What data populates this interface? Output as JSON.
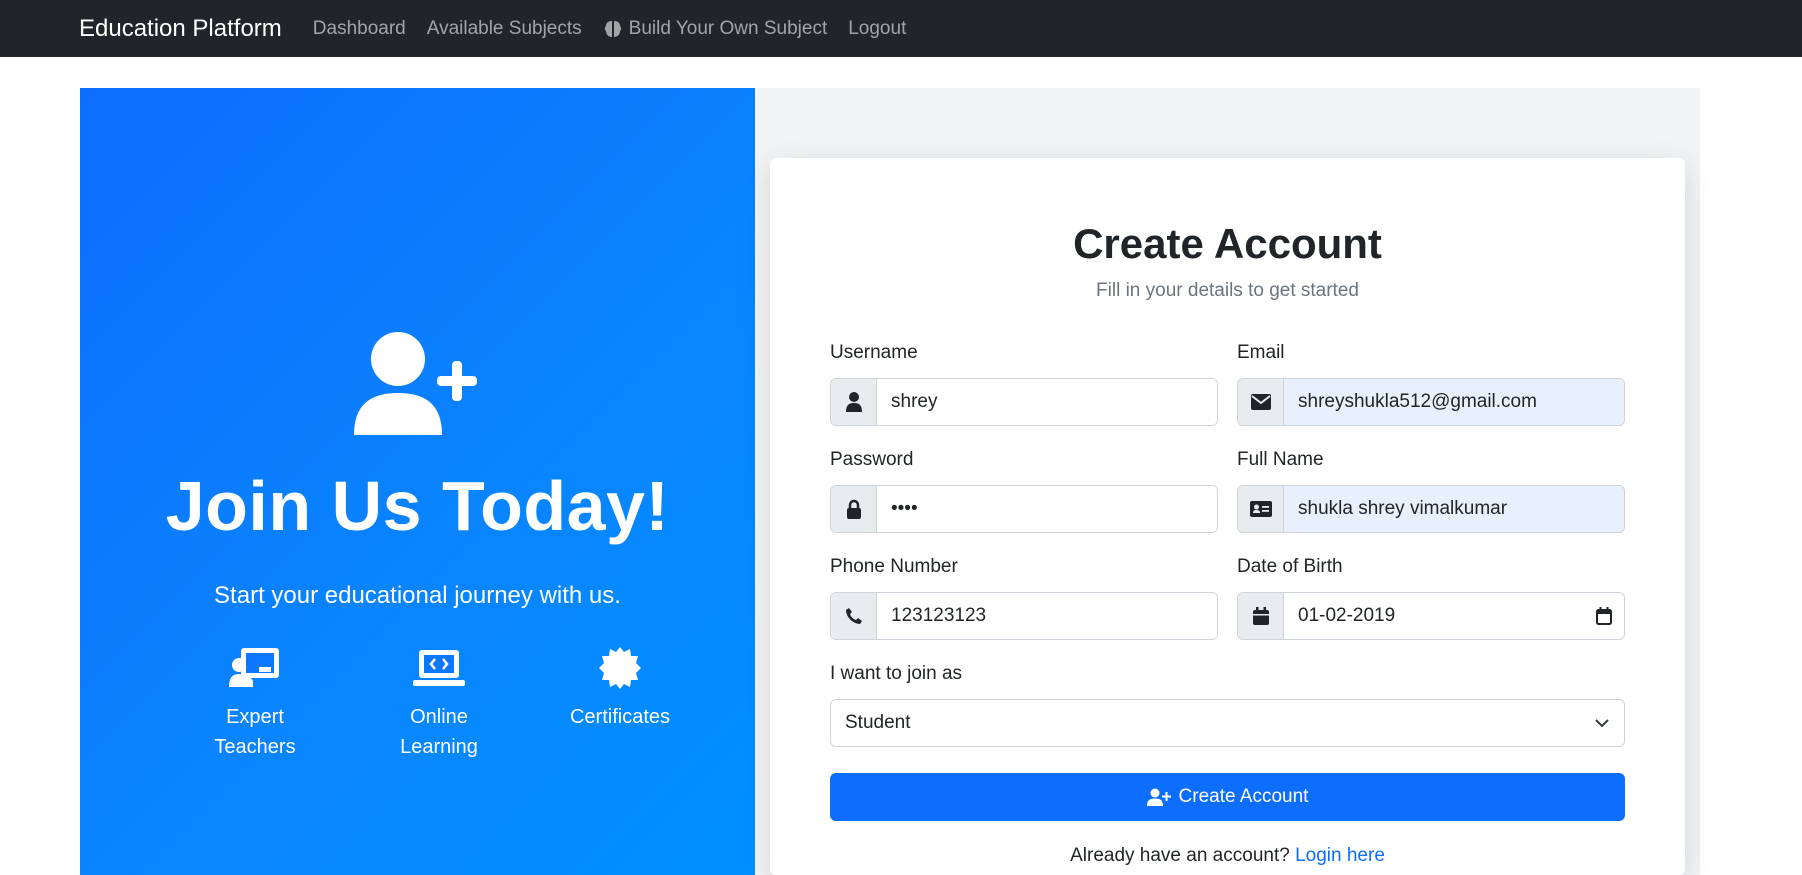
{
  "navbar": {
    "brand": "Education Platform",
    "links": [
      "Dashboard",
      "Available Subjects",
      "Build Your Own Subject",
      "Logout"
    ]
  },
  "hero": {
    "title": "Join Us Today!",
    "subtitle": "Start your educational journey with us.",
    "features": [
      {
        "line1": "Expert",
        "line2": "Teachers",
        "icon": "chalkboard-teacher-icon"
      },
      {
        "line1": "Online",
        "line2": "Learning",
        "icon": "laptop-code-icon"
      },
      {
        "line1": "Certificates",
        "line2": "",
        "icon": "certificate-icon"
      }
    ]
  },
  "form": {
    "title": "Create Account",
    "subtitle": "Fill in your details to get started",
    "username": {
      "label": "Username",
      "value": "shrey"
    },
    "email": {
      "label": "Email",
      "value": "shreyshukla512@gmail.com"
    },
    "password": {
      "label": "Password",
      "value": "shre"
    },
    "full_name": {
      "label": "Full Name",
      "value": "shukla shrey vimalkumar"
    },
    "phone": {
      "label": "Phone Number",
      "value": "123123123"
    },
    "dob": {
      "label": "Date of Birth",
      "value": "01-02-2019"
    },
    "role": {
      "label": "I want to join as",
      "selected": "Student"
    },
    "submit_label": "Create Account",
    "login_prompt": "Already have an account?",
    "login_link": "Login here"
  },
  "colors": {
    "navbar_bg": "#212529",
    "primary": "#0d6efd",
    "autofill_bg": "#e8f0fe"
  }
}
